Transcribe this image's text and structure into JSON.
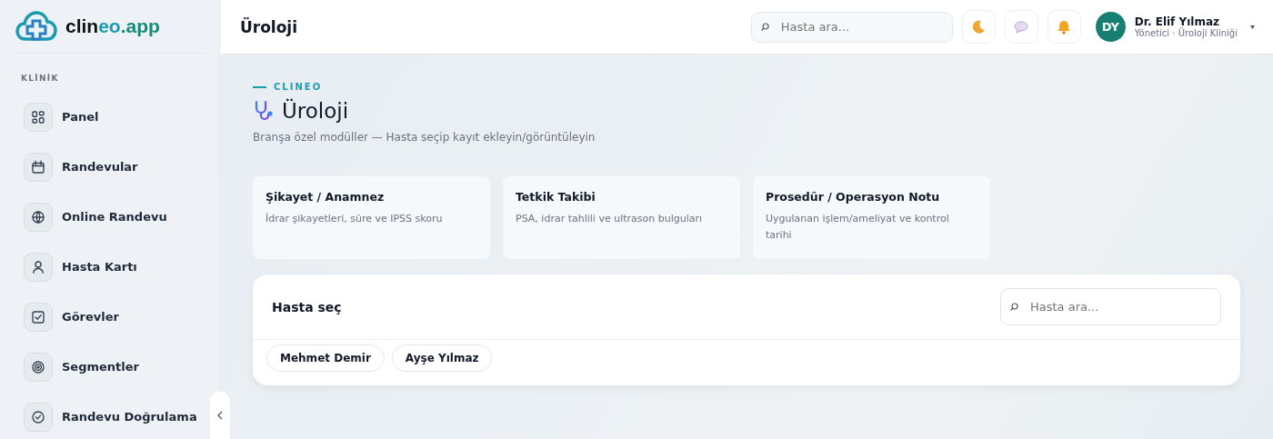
{
  "sidebar": {
    "logo": {
      "prefix": "clin",
      "highlight": "eo",
      "suffix": ".app"
    },
    "section": "KLİNİK",
    "items": [
      {
        "label": "Panel"
      },
      {
        "label": "Randevular"
      },
      {
        "label": "Online Randevu"
      },
      {
        "label": "Hasta Kartı"
      },
      {
        "label": "Görevler"
      },
      {
        "label": "Segmentler"
      },
      {
        "label": "Randevu Doğrulama"
      }
    ]
  },
  "header": {
    "title": "Üroloji",
    "search": {
      "placeholder": "Hasta ara..."
    },
    "user": {
      "initials": "DY",
      "name": "Dr. Elif Yılmaz",
      "role": "Yönetici · Üroloji Kliniği"
    }
  },
  "page": {
    "eyebrow": "CLINEO",
    "title": "Üroloji",
    "subtitle": "Branşa özel modüller — Hasta seçip kayıt ekleyin/görüntüleyin",
    "modules": [
      {
        "title": "Şikayet / Anamnez",
        "description": "İdrar şikayetleri, süre ve IPSS skoru"
      },
      {
        "title": "Tetkik Takibi",
        "description": "PSA, idrar tahlili ve ultrason bulguları"
      },
      {
        "title": "Prosedür / Operasyon Notu",
        "description": "Uygulanan işlem/ameliyat ve kontrol tarihi"
      }
    ],
    "patient_picker": {
      "title": "Hasta seç",
      "search": {
        "placeholder": "Hasta ara..."
      },
      "patients": [
        {
          "name": "Mehmet Demir"
        },
        {
          "name": "Ayşe Yılmaz"
        }
      ]
    }
  }
}
